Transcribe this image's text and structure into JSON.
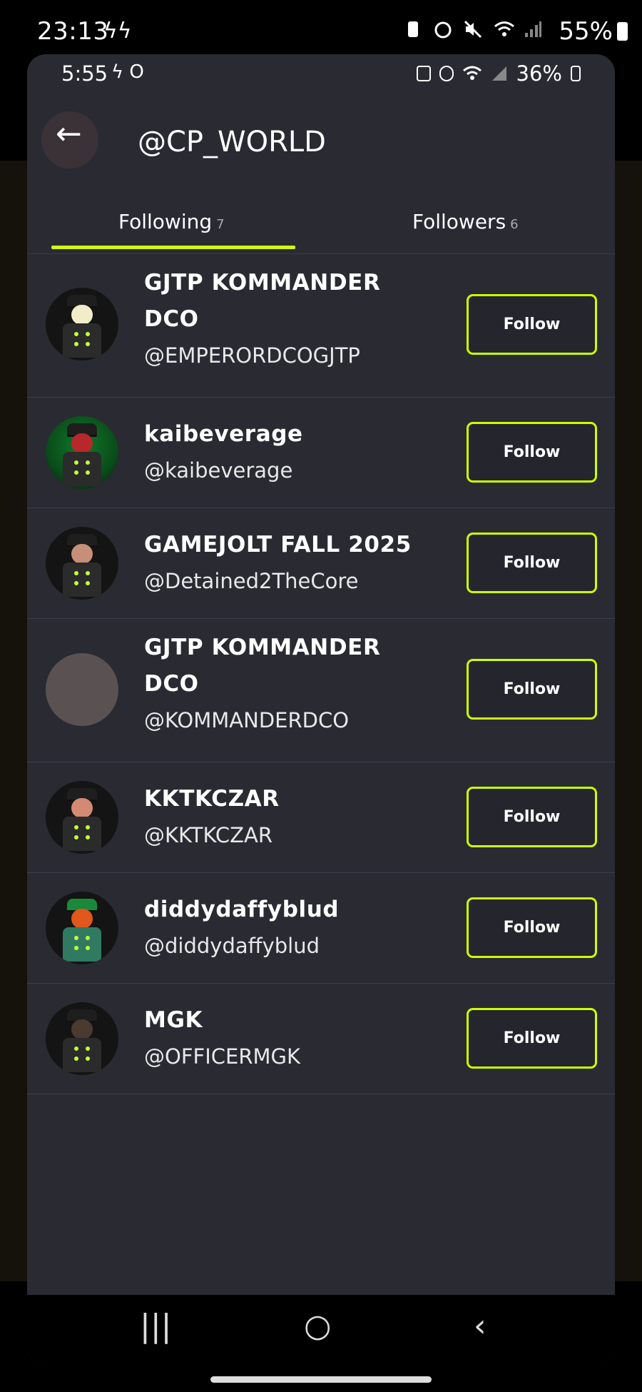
{
  "outer_status": {
    "time": "23:13",
    "bolts": "ϟϟ",
    "battery": "55%"
  },
  "inner_status": {
    "time": "5:55",
    "left_icons": "ϟ O",
    "battery": "36%"
  },
  "header": {
    "title": "@CP_WORLD",
    "back_icon": "←"
  },
  "tabs": [
    {
      "label": "Following",
      "count": "7",
      "active": true
    },
    {
      "label": "Followers",
      "count": "6",
      "active": false
    }
  ],
  "accent": "#ccff00",
  "users": [
    {
      "display_name": "GJTP KOMMANDER DCO",
      "username": "@EMPERORDCOGJTP",
      "button": "Follow",
      "face": "#f2ecc8"
    },
    {
      "display_name": "kaibeverage",
      "username": "@kaibeverage",
      "button": "Follow",
      "face": "#b8272a"
    },
    {
      "display_name": "GAMEJOLT FALL 2025",
      "username": "@Detained2TheCore",
      "button": "Follow",
      "face": "#c58f78"
    },
    {
      "display_name": "GJTP KOMMANDER DCO",
      "username": "@KOMMANDERDCO",
      "button": "Follow",
      "face": ""
    },
    {
      "display_name": "KKTKCZAR",
      "username": "@KKTKCZAR",
      "button": "Follow",
      "face": "#d48a72"
    },
    {
      "display_name": "diddydaffyblud",
      "username": "@diddydaffyblud",
      "button": "Follow",
      "face": "#e2571c"
    },
    {
      "display_name": "MGK",
      "username": "@OFFICERMGK",
      "button": "Follow",
      "face": "#4a3a30"
    }
  ],
  "nav": {
    "recent": "|||",
    "home": "○",
    "back": "‹"
  }
}
